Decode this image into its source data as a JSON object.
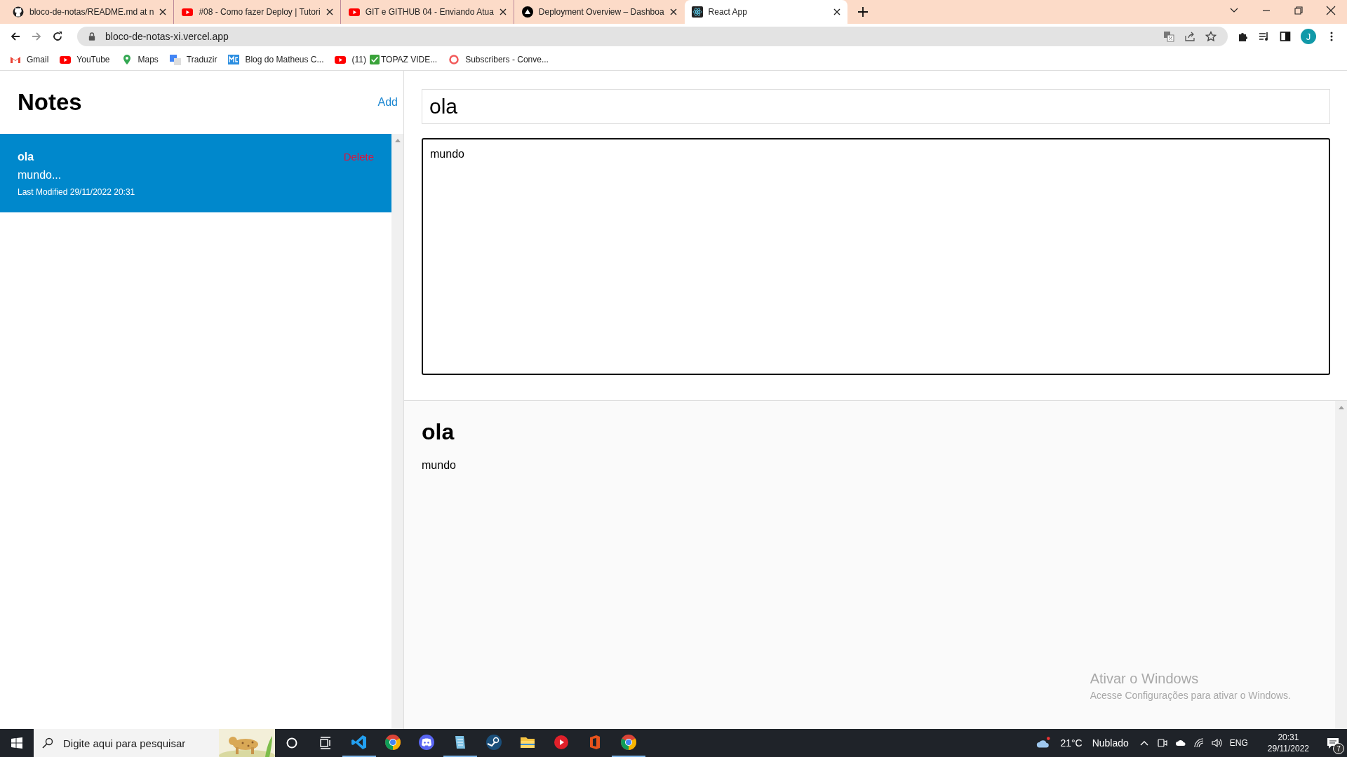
{
  "browser": {
    "tabs": [
      {
        "kind": "github",
        "title": "bloco-de-notas/README.md at n",
        "selected": false
      },
      {
        "kind": "youtube",
        "title": "#08 - Como fazer Deploy | Tutori",
        "selected": false
      },
      {
        "kind": "youtube",
        "title": "GIT e GITHUB 04 - Enviando Atua",
        "selected": false
      },
      {
        "kind": "vercel",
        "title": "Deployment Overview – Dashboa",
        "selected": false
      },
      {
        "kind": "react",
        "title": "React App",
        "selected": true
      }
    ],
    "url": "bloco-de-notas-xi.vercel.app",
    "avatar": "J",
    "bookmarks": [
      {
        "kind": "gmail",
        "label": "Gmail"
      },
      {
        "kind": "youtube",
        "label": "YouTube"
      },
      {
        "kind": "maps",
        "label": "Maps"
      },
      {
        "kind": "translate",
        "label": "Traduzir"
      },
      {
        "kind": "blog",
        "label": "Blog do Matheus C..."
      },
      {
        "kind": "youtube",
        "label": "(11)",
        "suffix": "TOPAZ VIDE..."
      },
      {
        "kind": "ring",
        "label": "Subscribers - Conve..."
      }
    ]
  },
  "sidebar": {
    "title": "Notes",
    "add": "Add",
    "notes": [
      {
        "title": "ola",
        "preview": "mundo...",
        "modified": "Last Modified 29/11/2022 20:31",
        "delete": "Delete",
        "selected": true
      }
    ]
  },
  "editor": {
    "title": "ola",
    "body": "mundo"
  },
  "preview": {
    "title": "ola",
    "body": "mundo"
  },
  "activation_notice": {
    "title": "Ativar o Windows",
    "text": "Acesse Configurações para ativar o Windows."
  },
  "taskbar": {
    "search": {
      "placeholder": "Digite aqui para pesquisar"
    },
    "apps": [
      {
        "kind": "vscode",
        "running": true
      },
      {
        "kind": "chrome",
        "running": false
      },
      {
        "kind": "discord",
        "running": false
      },
      {
        "kind": "notepad",
        "running": true
      },
      {
        "kind": "steam",
        "running": false
      },
      {
        "kind": "folder",
        "running": false
      },
      {
        "kind": "player",
        "running": false
      },
      {
        "kind": "office",
        "running": false
      },
      {
        "kind": "chrome",
        "running": true
      }
    ],
    "weather": {
      "temp": "21°C",
      "condition": "Nublado"
    },
    "language": "ENG",
    "time": "20:31",
    "date": "29/11/2022",
    "notifications": "7"
  }
}
